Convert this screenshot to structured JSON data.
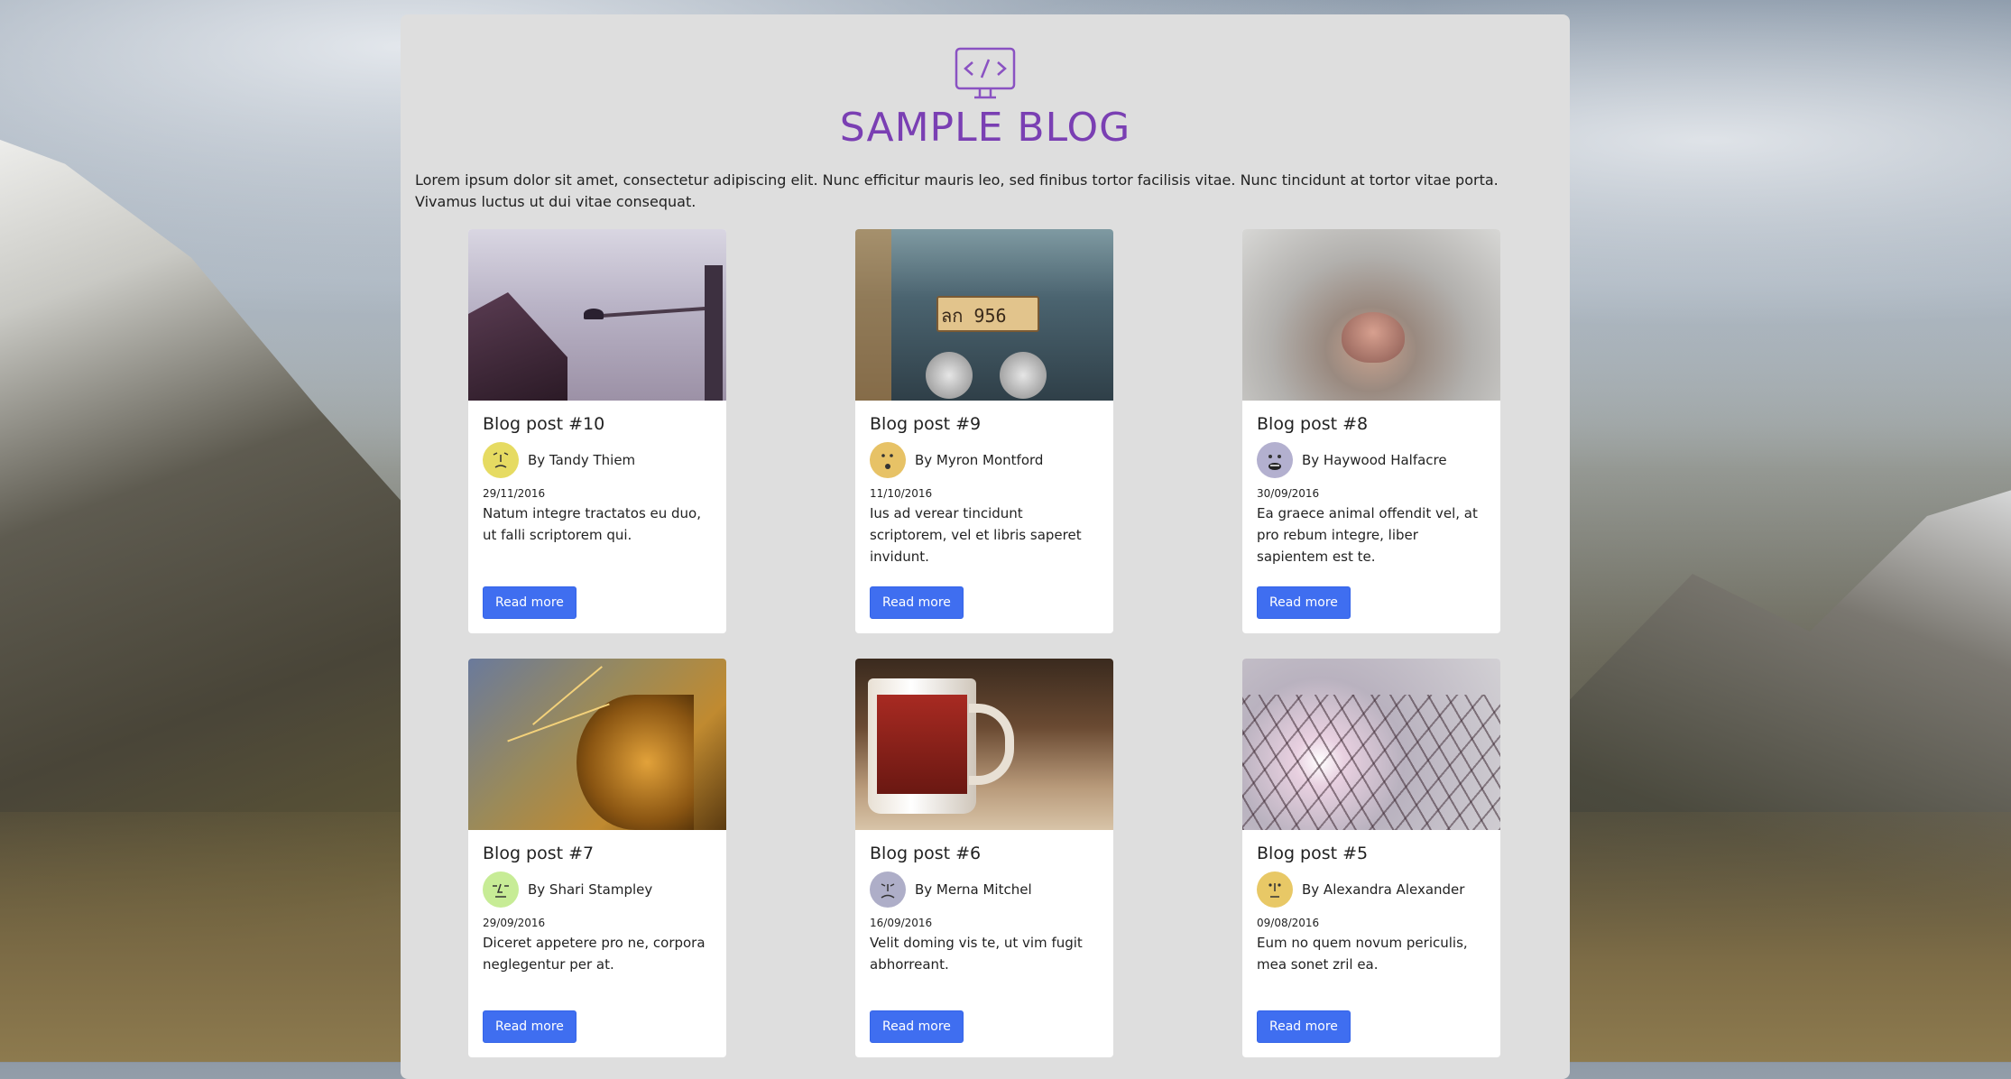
{
  "site": {
    "title": "SAMPLE BLOG",
    "logo_icon": "code-monitor-icon",
    "intro": "Lorem ipsum dolor sit amet, consectetur adipiscing elit. Nunc efficitur mauris leo, sed finibus tortor facilisis vitae. Nunc tincidunt at tortor vitae porta. Vivamus luctus ut dui vitae consequat.",
    "accent_color": "#7a3fb3",
    "button_color": "#3f6ef0"
  },
  "posts": [
    {
      "title": "Blog post #10",
      "author": "By Tandy Thiem",
      "date": "29/11/2016",
      "excerpt": "Natum integre tractatos eu duo, ut falli scriptorem qui.",
      "button": "Read more",
      "avatar_color": "#e6db62",
      "image": "boat-bird-photo"
    },
    {
      "title": "Blog post #9",
      "author": "By Myron Montford",
      "date": "11/10/2016",
      "excerpt": "Ius ad verear tincidunt scriptorem, vel et libris saperet invidunt.",
      "button": "Read more",
      "avatar_color": "#e7c266",
      "image": "tuktuk-plate-photo"
    },
    {
      "title": "Blog post #8",
      "author": "By Haywood Halfacre",
      "date": "30/09/2016",
      "excerpt": "Ea graece animal offendit vel, at pro rebum integre, liber sapientem est te.",
      "button": "Read more",
      "avatar_color": "#b3b0cf",
      "image": "cat-nose-photo"
    },
    {
      "title": "Blog post #7",
      "author": "By Shari Stampley",
      "date": "29/09/2016",
      "excerpt": "Diceret appetere pro ne, corpora neglegentur per at.",
      "button": "Read more",
      "avatar_color": "#c7ec96",
      "image": "cactus-photo"
    },
    {
      "title": "Blog post #6",
      "author": "By Merna Mitchel",
      "date": "16/09/2016",
      "excerpt": "Velit doming vis te, ut vim fugit abhorreant.",
      "button": "Read more",
      "avatar_color": "#aeaec8",
      "image": "mug-photo"
    },
    {
      "title": "Blog post #5",
      "author": "By Alexandra Alexander",
      "date": "09/08/2016",
      "excerpt": "Eum no quem novum periculis, mea sonet zril ea.",
      "button": "Read more",
      "avatar_color": "#e8c866",
      "image": "tree-branches-photo"
    }
  ]
}
